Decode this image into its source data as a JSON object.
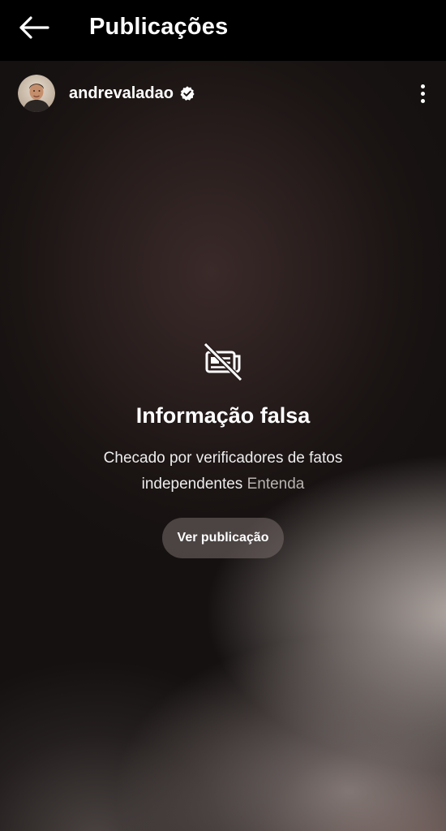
{
  "app_bar": {
    "back_icon": "arrow-left-icon",
    "title": "Publicações"
  },
  "post": {
    "username": "andrevaladao",
    "verified_icon": "verified-badge-icon",
    "more_icon": "more-vertical-icon"
  },
  "warning": {
    "icon": "false-information-icon",
    "title": "Informação falsa",
    "description": "Checado por verificadores de fatos independentes",
    "learn_more": "Entenda",
    "view_button": "Ver publicação"
  },
  "colors": {
    "background": "#000000",
    "link": "#b9b3b1",
    "button_bg": "#6f6664"
  }
}
